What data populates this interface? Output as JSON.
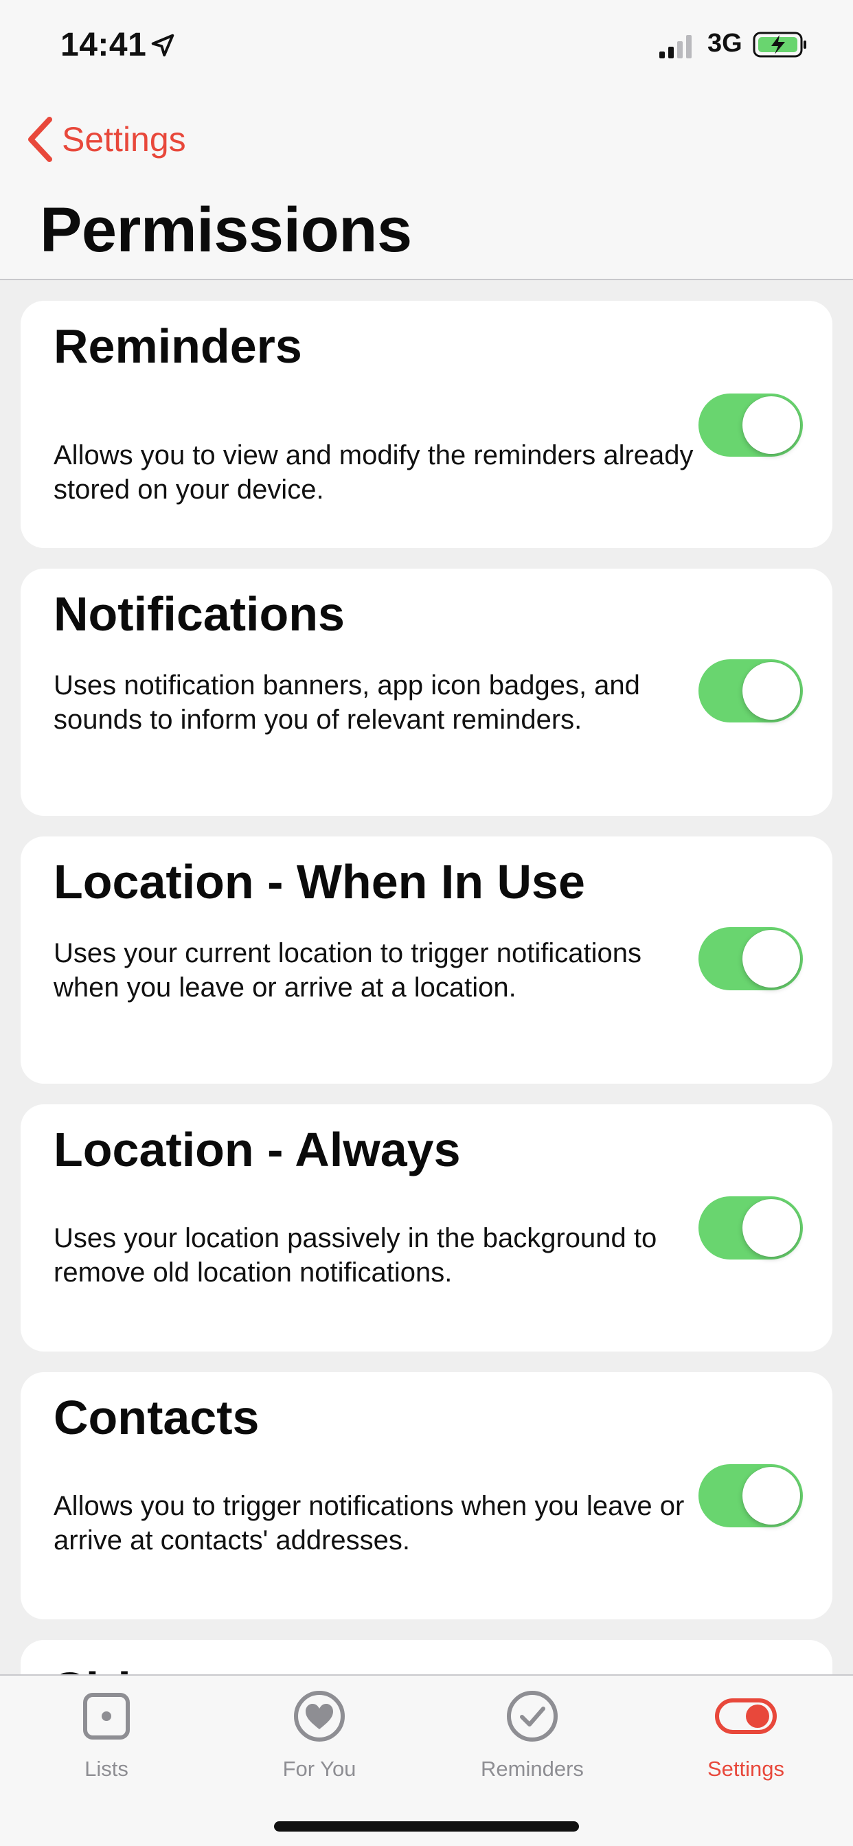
{
  "status_bar": {
    "time": "14:41",
    "network": "3G",
    "icons": [
      "location-arrow-icon",
      "cellular-signal-icon",
      "battery-charging-icon"
    ]
  },
  "header": {
    "back_label": "Settings",
    "title": "Permissions"
  },
  "permissions": [
    {
      "title": "Reminders",
      "description": "Allows you to view and modify the reminders already stored on your device.",
      "enabled": true
    },
    {
      "title": "Notifications",
      "description": "Uses notification banners, app icon badges, and sounds to inform you of relevant reminders.",
      "enabled": true
    },
    {
      "title": "Location - When In Use",
      "description": "Uses your current location to trigger notifications when you leave or arrive at a location.",
      "enabled": true
    },
    {
      "title": "Location - Always",
      "description": "Uses your location passively in the background to remove old location notifications.",
      "enabled": true
    },
    {
      "title": "Contacts",
      "description": "Allows you to trigger notifications when you leave or arrive at contacts' addresses.",
      "enabled": true
    },
    {
      "title": "Siri",
      "description": "",
      "enabled": true
    }
  ],
  "tab_bar": {
    "tabs": [
      {
        "label": "Lists",
        "icon": "square-dot-icon",
        "active": false
      },
      {
        "label": "For You",
        "icon": "heart-circle-icon",
        "active": false
      },
      {
        "label": "Reminders",
        "icon": "checkmark-circle-icon",
        "active": false
      },
      {
        "label": "Settings",
        "icon": "toggle-switch-icon",
        "active": true
      }
    ]
  },
  "colors": {
    "accent": "#e8483b",
    "toggle_on": "#69d56f",
    "background": "#efefef",
    "card": "#ffffff",
    "inactive_tab": "#8e8e93"
  }
}
